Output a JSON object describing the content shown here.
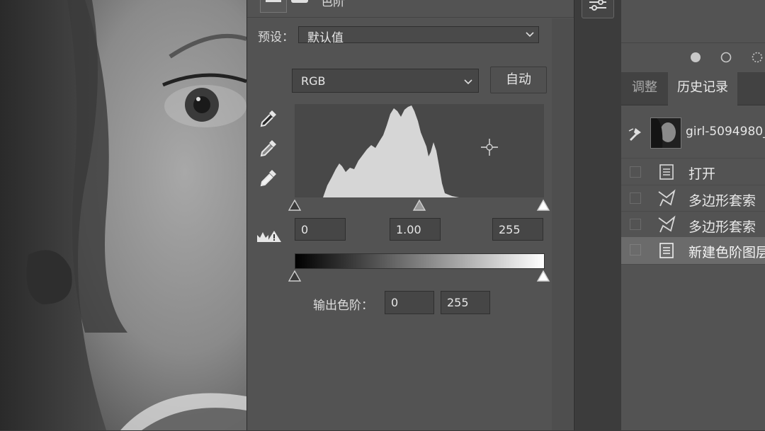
{
  "properties": {
    "panel_title": "色阶",
    "preset_label": "预设：",
    "preset_value": "默认值",
    "channel_value": "RGB",
    "auto_button": "自动",
    "input_black": "0",
    "input_gamma": "1.00",
    "input_white": "255",
    "output_label": "输出色阶：",
    "output_black": "0",
    "output_white": "255"
  },
  "history_panel": {
    "tabs": [
      {
        "label": "调整",
        "active": false
      },
      {
        "label": "历史记录",
        "active": true
      }
    ],
    "snapshot_name": "girl-5094980_",
    "items": [
      {
        "label": "打开",
        "icon": "document-icon"
      },
      {
        "label": "多边形套索",
        "icon": "polygonal-lasso-icon"
      },
      {
        "label": "多边形套索",
        "icon": "polygonal-lasso-icon"
      },
      {
        "label": "新建色阶图层",
        "icon": "document-icon",
        "selected": true
      }
    ]
  },
  "colors": {
    "panel_bg": "#535353",
    "field_bg": "#464646",
    "histogram_bg": "#484848",
    "histogram_fill": "#d6d6d6"
  }
}
